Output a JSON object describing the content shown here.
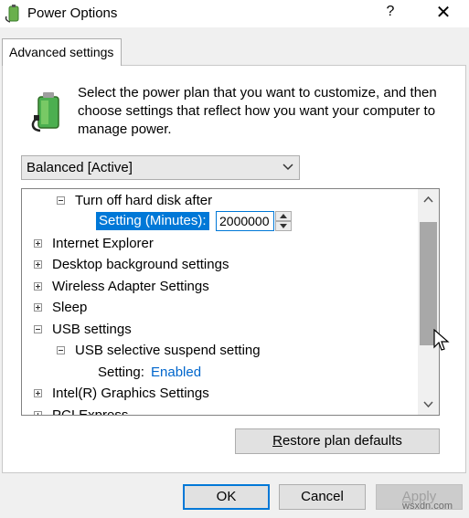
{
  "window": {
    "title": "Power Options",
    "help_label": "?",
    "close_label": "✕"
  },
  "tab": {
    "label": "Advanced settings"
  },
  "description": "Select the power plan that you want to customize, and then choose settings that reflect how you want your computer to manage power.",
  "plan_select": {
    "value": "Balanced [Active]"
  },
  "tree": {
    "hard_disk": {
      "label": "Turn off hard disk after",
      "expanded": true
    },
    "setting_row": {
      "label": "Setting (Minutes):",
      "value": "2000000"
    },
    "items": [
      {
        "label": "Internet Explorer",
        "toggle": "+"
      },
      {
        "label": "Desktop background settings",
        "toggle": "+"
      },
      {
        "label": "Wireless Adapter Settings",
        "toggle": "+"
      },
      {
        "label": "Sleep",
        "toggle": "+"
      },
      {
        "label": "USB settings",
        "toggle": "−"
      }
    ],
    "usb_suspend": {
      "label": "USB selective suspend setting",
      "toggle": "−"
    },
    "usb_setting": {
      "label": "Setting:",
      "value": "Enabled"
    },
    "intel": {
      "label": "Intel(R) Graphics Settings",
      "toggle": "+"
    },
    "pci": {
      "label": "PCI Express",
      "toggle": "+"
    }
  },
  "buttons": {
    "restore_first": "R",
    "restore_rest": "estore plan defaults",
    "ok": "OK",
    "cancel": "Cancel",
    "apply_first": "A",
    "apply_rest": "pply"
  },
  "watermark": "wsxdn.com",
  "colors": {
    "selection": "#0078d7",
    "link_value": "#0066cc"
  }
}
